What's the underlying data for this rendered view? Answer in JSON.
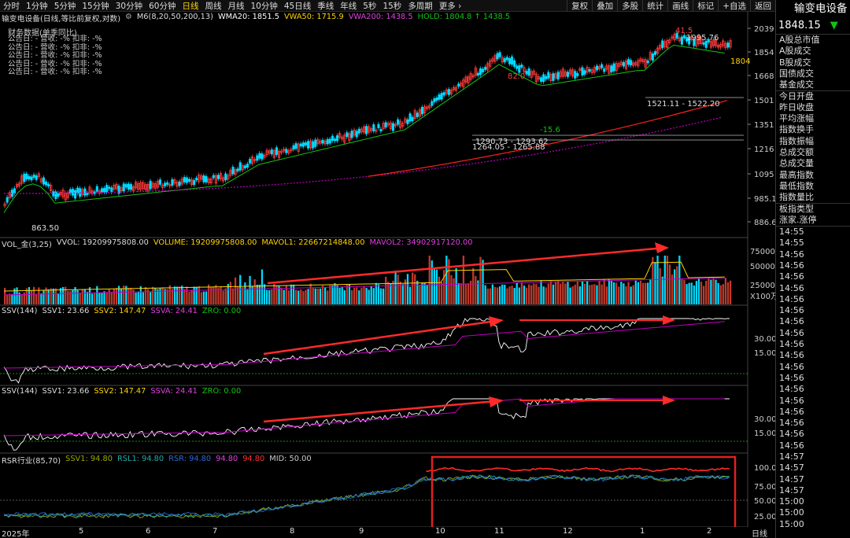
{
  "toolbar": {
    "periods": [
      "分时",
      "1分钟",
      "5分钟",
      "15分钟",
      "30分钟",
      "60分钟",
      "日线",
      "周线",
      "月线",
      "10分钟",
      "45日线",
      "季线",
      "年线",
      "5秒",
      "15秒",
      "多周期",
      "更多 ›"
    ],
    "active_index": 6,
    "tools": [
      "复权",
      "叠加",
      "多股",
      "统计",
      "画线",
      "标记",
      "+自选",
      "返回"
    ]
  },
  "main_chart": {
    "title": "输变电设备(日线,等比前复权,对数)",
    "ma_label": "M6(8,20,50,200,13)",
    "wma20": "WMA20: 1851.5",
    "vwa50": "VWA50: 1715.9",
    "vwa200": "VWA200: 1438.5",
    "hold": "HOLD: 1804.8 ↑ 1438.5",
    "fin_title": "财务数据(单季同比)",
    "fin_rows": [
      "公告日: -  营收: -%  扣非: -%",
      "公告日: -  营收: -%  扣非: -%",
      "公告日: -  营收: -%  扣非: -%",
      "公告日: -  营收: -%  扣非: -%",
      "公告日: -  营收: -%  扣非: -%"
    ],
    "y_ticks": [
      "2039",
      "1854",
      "1668",
      "1501",
      "1351",
      "1216",
      "1095",
      "985.1",
      "886.6"
    ],
    "annotations": [
      "41.5",
      "1995.76",
      "1804",
      "82.0",
      "-15.6",
      "1521.11 - 1522.20",
      "1290.73 - 1293.62",
      "1264.05 - 1265.88",
      "863.50"
    ]
  },
  "vol_panel": {
    "label": "VOL_金(3,25)",
    "vvol": "VVOL: 19209975808.00",
    "volume": "VOLUME: 19209975808.00",
    "mavol1": "MAVOL1: 22667214848.00",
    "mavol2": "MAVOL2: 34902917120.00",
    "y_ticks": [
      "75000",
      "50000",
      "25000",
      "X100万"
    ]
  },
  "ssv_panel_1": {
    "label": "SSV(144)",
    "ssv1": "SSV1: 23.66",
    "ssv2": "SSV2: 147.47",
    "ssva": "SSVA: 24.41",
    "zro": "ZRO: 0.00",
    "y_ticks": [
      "30.00",
      "15.00"
    ]
  },
  "ssv_panel_2": {
    "label": "SSV(144)",
    "ssv1": "SSV1: 23.66",
    "ssv2": "SSV2: 147.47",
    "ssva": "SSVA: 24.41",
    "zro": "ZRO: 0.00",
    "y_ticks": [
      "30.00",
      "15.00"
    ]
  },
  "rsr_panel": {
    "label": "RSR行业(85,70)",
    "ssv1": "SSV1: 94.80",
    "rsl1": "RSL1: 94.80",
    "rsr": "RSR: 94.80",
    "v1": "94.80",
    "v2": "94.80",
    "mid": "MID: 50.00",
    "y_ticks": [
      "100.0",
      "75.00",
      "50.00",
      "25.00"
    ]
  },
  "x_axis": {
    "labels": [
      "2025年",
      "5",
      "6",
      "7",
      "8",
      "9",
      "10",
      "11",
      "12",
      "1",
      "2"
    ],
    "period": "日线"
  },
  "right_panel": {
    "title": "输变电设备",
    "price": "1848.15",
    "arrow": "▼",
    "fields": [
      "A股总市值",
      "A股成交",
      "B股成交",
      "国债成交",
      "基金成交",
      "今日开盘",
      "昨日收盘",
      "平均涨幅",
      "指数换手",
      "指数振幅",
      "总成交额",
      "总成交量",
      "最高指数",
      "最低指数",
      "指数量比",
      "板指类型",
      "涨家.涨停"
    ],
    "times": [
      "14:55",
      "14:55",
      "14:56",
      "14:56",
      "14:56",
      "14:56",
      "14:56",
      "14:56",
      "14:56",
      "14:56",
      "14:56",
      "14:56",
      "14:56",
      "14:56",
      "14:56",
      "14:56",
      "14:56",
      "14:56",
      "14:56",
      "14:56",
      "14:57",
      "14:57",
      "14:57",
      "14:57",
      "15:00",
      "15:00",
      "15:00"
    ]
  },
  "colors": {
    "up": "#ff3b3b",
    "down": "#00d9ff",
    "ma_green": "#12c312",
    "ma_magenta": "#c000c0",
    "ma_red": "#ff2020",
    "highlight_box": "#e02020"
  }
}
